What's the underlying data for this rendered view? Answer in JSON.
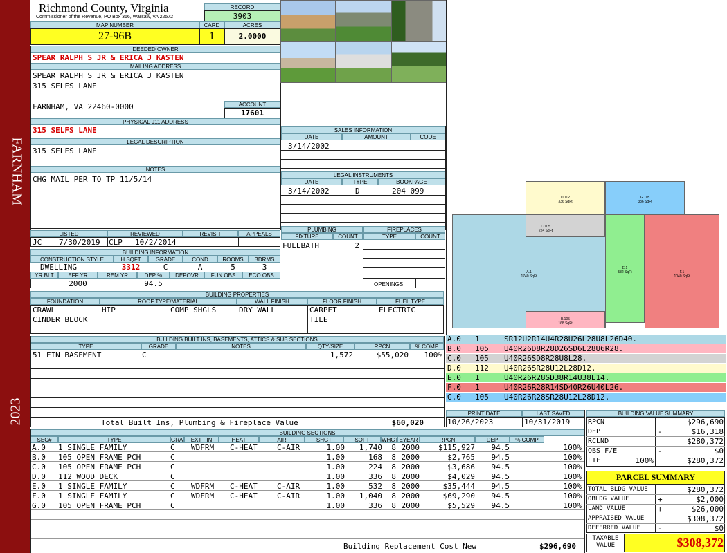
{
  "county": "Richmond County, Virginia",
  "commissioner": "Commissioner of the Revenue, PO Box 366, Warsaw, VA 22572",
  "sidebar": {
    "district": "FARNHAM",
    "year": "2023"
  },
  "record": {
    "label": "RECORD",
    "value": "3903"
  },
  "map": {
    "label": "MAP NUMBER",
    "value": "27-96B"
  },
  "card": {
    "label": "CARD",
    "value": "1"
  },
  "acres": {
    "label": "ACRES",
    "value": "2.0000"
  },
  "owner": {
    "label": "DEEDED OWNER",
    "value": "SPEAR RALPH S JR & ERICA J KASTEN"
  },
  "mailing": {
    "label": "MAILING ADDRESS",
    "line1": "SPEAR RALPH S JR & ERICA J KASTEN",
    "line2": "315 SELFS LANE",
    "line3": "FARNHAM, VA 22460-0000"
  },
  "account": {
    "label": "ACCOUNT",
    "value": "17601"
  },
  "physical": {
    "label": "PHYSICAL 911 ADDRESS",
    "value": "315 SELFS LANE"
  },
  "legal": {
    "label": "LEGAL DESCRIPTION",
    "value": "315 SELFS LANE"
  },
  "notes": {
    "label": "NOTES",
    "value": "CHG MAIL PER TO TP 11/5/14"
  },
  "sales": {
    "label": "SALES INFORMATION",
    "cols": [
      "DATE",
      "AMOUNT",
      "CODE"
    ],
    "date": "3/14/2002"
  },
  "instruments": {
    "label": "LEGAL INSTRUMENTS",
    "cols": [
      "DATE",
      "TYPE",
      "BOOKPAGE"
    ],
    "date": "3/14/2002",
    "type": "D",
    "bookpage": "204 099"
  },
  "listed": {
    "label": "LISTED",
    "by": "JC",
    "date": "7/30/2019"
  },
  "reviewed": {
    "label": "REVIEWED",
    "by": "CLP",
    "date": "10/2/2014"
  },
  "revisit": {
    "label": "REVISIT"
  },
  "appeals": {
    "label": "APPEALS"
  },
  "bldg_info": {
    "label": "BUILDING INFORMATION",
    "cols": [
      "CONSTRUCTION STYLE",
      "H SQFT",
      "GRADE",
      "COND",
      "ROOMS",
      "BDRMS"
    ],
    "style": "DWELLING",
    "hsqft": "3312",
    "grade": "C",
    "cond": "A",
    "rooms": "5",
    "bdrms": "3",
    "cols2": [
      "YR BLT",
      "EFF YR",
      "REM YR",
      "DEP %",
      "DEPOVR",
      "FUN OBS",
      "ECO OBS"
    ],
    "effyr": "2000",
    "dep": "94.5"
  },
  "plumbing": {
    "label": "PLUMBING",
    "cols": [
      "FIXTURE",
      "COUNT"
    ],
    "fixture": "FULLBATH",
    "count": "2"
  },
  "fireplaces": {
    "label": "FIREPLACES",
    "cols": [
      "TYPE",
      "COUNT"
    ],
    "openings": "OPENINGS"
  },
  "props": {
    "label": "BUILDING PROPERTIES",
    "cols": [
      "FOUNDATION",
      "ROOF TYPE/MATERIAL",
      "WALL FINISH",
      "FLOOR FINISH",
      "FUEL TYPE"
    ],
    "found1": "CRAWL",
    "found2": "CINDER BLOCK",
    "roof1": "HIP",
    "roof2": "COMP SHGLS",
    "wall": "DRY WALL",
    "floor1": "CARPET",
    "floor2": "TILE",
    "fuel": "ELECTRIC"
  },
  "builtins": {
    "label": "BUILDING BUILT INS, BASEMENTS, ATTICS & SUB SECTIONS",
    "cols": [
      "TYPE",
      "GRADE",
      "NOTES",
      "QTY/SIZE",
      "RPCN",
      "% COMP"
    ],
    "row": {
      "type": "51 FIN BASEMENT",
      "grade": "C",
      "qty": "1,572",
      "rpcn": "$55,020",
      "comp": "100%"
    },
    "total_label": "Total Built Ins, Plumbing & Fireplace Value",
    "total": "$60,020"
  },
  "print": {
    "label": "PRINT DATE",
    "value": "10/26/2023"
  },
  "saved": {
    "label": "LAST SAVED",
    "value": "10/31/2019"
  },
  "segments": [
    {
      "sec": "A.0",
      "code": "1",
      "path": "SR12U2R14U4R28U26L28U8L26D40.",
      "color": "#add8e6"
    },
    {
      "sec": "B.0",
      "code": "105",
      "path": "U40R26D8R28D26SD6L28U6R28.",
      "color": "#ffb6c1"
    },
    {
      "sec": "C.0",
      "code": "105",
      "path": "U40R26SD8R28U8L28.",
      "color": "#d3d3d3"
    },
    {
      "sec": "D.0",
      "code": "112",
      "path": "U40R26SR28U12L28D12.",
      "color": "#fffacd"
    },
    {
      "sec": "E.0",
      "code": "1",
      "path": "U40R26R28SD38R14U38L14.",
      "color": "#90ee90"
    },
    {
      "sec": "F.0",
      "code": "1",
      "path": "U40R26R28R14SD40R26U40L26.",
      "color": "#f08080"
    },
    {
      "sec": "G.0",
      "code": "105",
      "path": "U40R26R28SR28U12L28D12.",
      "color": "#87cefa"
    }
  ],
  "sketch_labels": {
    "a": "A.1",
    "a_area": "1740 SqFt",
    "b": "B.105",
    "b_area": "168 SqFt",
    "c": "C.105",
    "c_area": "224 SqFt",
    "d": "D.112",
    "d_area": "336 SqFt",
    "e": "E.1",
    "e_area": "532 SqFt",
    "f": "F.1",
    "f_area": "1040 SqFt",
    "g": "G.105",
    "g_area": "336 SqFt"
  },
  "sections": {
    "label": "BUILDING SECTIONS",
    "cols": [
      "SEC#",
      "TYPE",
      "GRADE",
      "EXT FIN",
      "HEAT",
      "AIR",
      "SHGT",
      "SQFT",
      "WHGT",
      "EYEAR",
      "RPCN",
      "DEP",
      "% COMP"
    ],
    "rows": [
      [
        "A.0",
        "1 SINGLE FAMILY",
        "C",
        "WDFRM",
        "C-HEAT",
        "C-AIR",
        "1.00",
        "1,740",
        "8",
        "2000",
        "$115,927",
        "94.5",
        "100%"
      ],
      [
        "B.0",
        "105 OPEN FRAME PCH",
        "C",
        "",
        "",
        "",
        "1.00",
        "168",
        "8",
        "2000",
        "$2,765",
        "94.5",
        "100%"
      ],
      [
        "C.0",
        "105 OPEN FRAME PCH",
        "C",
        "",
        "",
        "",
        "1.00",
        "224",
        "8",
        "2000",
        "$3,686",
        "94.5",
        "100%"
      ],
      [
        "D.0",
        "112 WOOD DECK",
        "C",
        "",
        "",
        "",
        "1.00",
        "336",
        "8",
        "2000",
        "$4,029",
        "94.5",
        "100%"
      ],
      [
        "E.0",
        "1 SINGLE FAMILY",
        "C",
        "WDFRM",
        "C-HEAT",
        "C-AIR",
        "1.00",
        "532",
        "8",
        "2000",
        "$35,444",
        "94.5",
        "100%"
      ],
      [
        "F.0",
        "1 SINGLE FAMILY",
        "C",
        "WDFRM",
        "C-HEAT",
        "C-AIR",
        "1.00",
        "1,040",
        "8",
        "2000",
        "$69,290",
        "94.5",
        "100%"
      ],
      [
        "G.0",
        "105 OPEN FRAME PCH",
        "C",
        "",
        "",
        "",
        "1.00",
        "336",
        "8",
        "2000",
        "$5,529",
        "94.5",
        "100%"
      ]
    ],
    "total_label": "Building Replacement Cost New",
    "total": "$296,690"
  },
  "bvs": {
    "label": "BUILDING VALUE SUMMARY",
    "rpcn_l": "RPCN",
    "rpcn": "$296,690",
    "dep_l": "DEP",
    "dep_s": "-",
    "dep": "$16,318",
    "rclnd_l": "RCLND",
    "rclnd": "$280,372",
    "obs_l": "OBS F/E",
    "obs_s": "-",
    "obs": "$0",
    "ltf_l": "LTF",
    "ltf_p": "100%",
    "ltf": "$280,372"
  },
  "parcel": {
    "label": "PARCEL SUMMARY",
    "tbv_l": "TOTAL BLDG VALUE",
    "tbv": "$280,372",
    "ob_l": "OBLDG VALUE",
    "ob_s": "+",
    "ob": "$2,000",
    "land_l": "LAND VALUE",
    "land_s": "+",
    "land": "$26,000",
    "appr_l": "APPRAISED VALUE",
    "appr": "$308,372",
    "def_l": "DEFERRED VALUE",
    "def_s": "-",
    "def": "$0",
    "tax_l1": "TAXABLE",
    "tax_l2": "VALUE",
    "tax": "$308,372"
  }
}
